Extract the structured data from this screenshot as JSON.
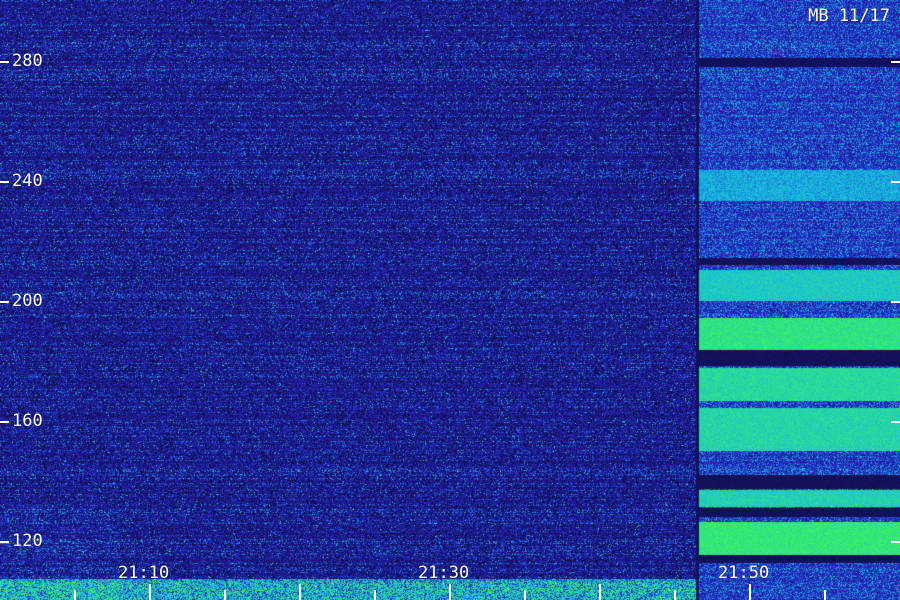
{
  "station_label": "MB 11/17",
  "frequency_axis": {
    "labels": [
      "280",
      "240",
      "200",
      "160",
      "120"
    ],
    "values": [
      280,
      240,
      200,
      160,
      120
    ]
  },
  "time_axis": {
    "labels": [
      "21:10",
      "21:30",
      "21:50"
    ]
  },
  "colors": {
    "background": "#0c0c3a",
    "noise_low": "#1c1c90",
    "noise_high": "#3b5bff",
    "signal_cyan": "#19c8e6",
    "signal_green": "#39f06a",
    "text": "#ffffff"
  }
}
